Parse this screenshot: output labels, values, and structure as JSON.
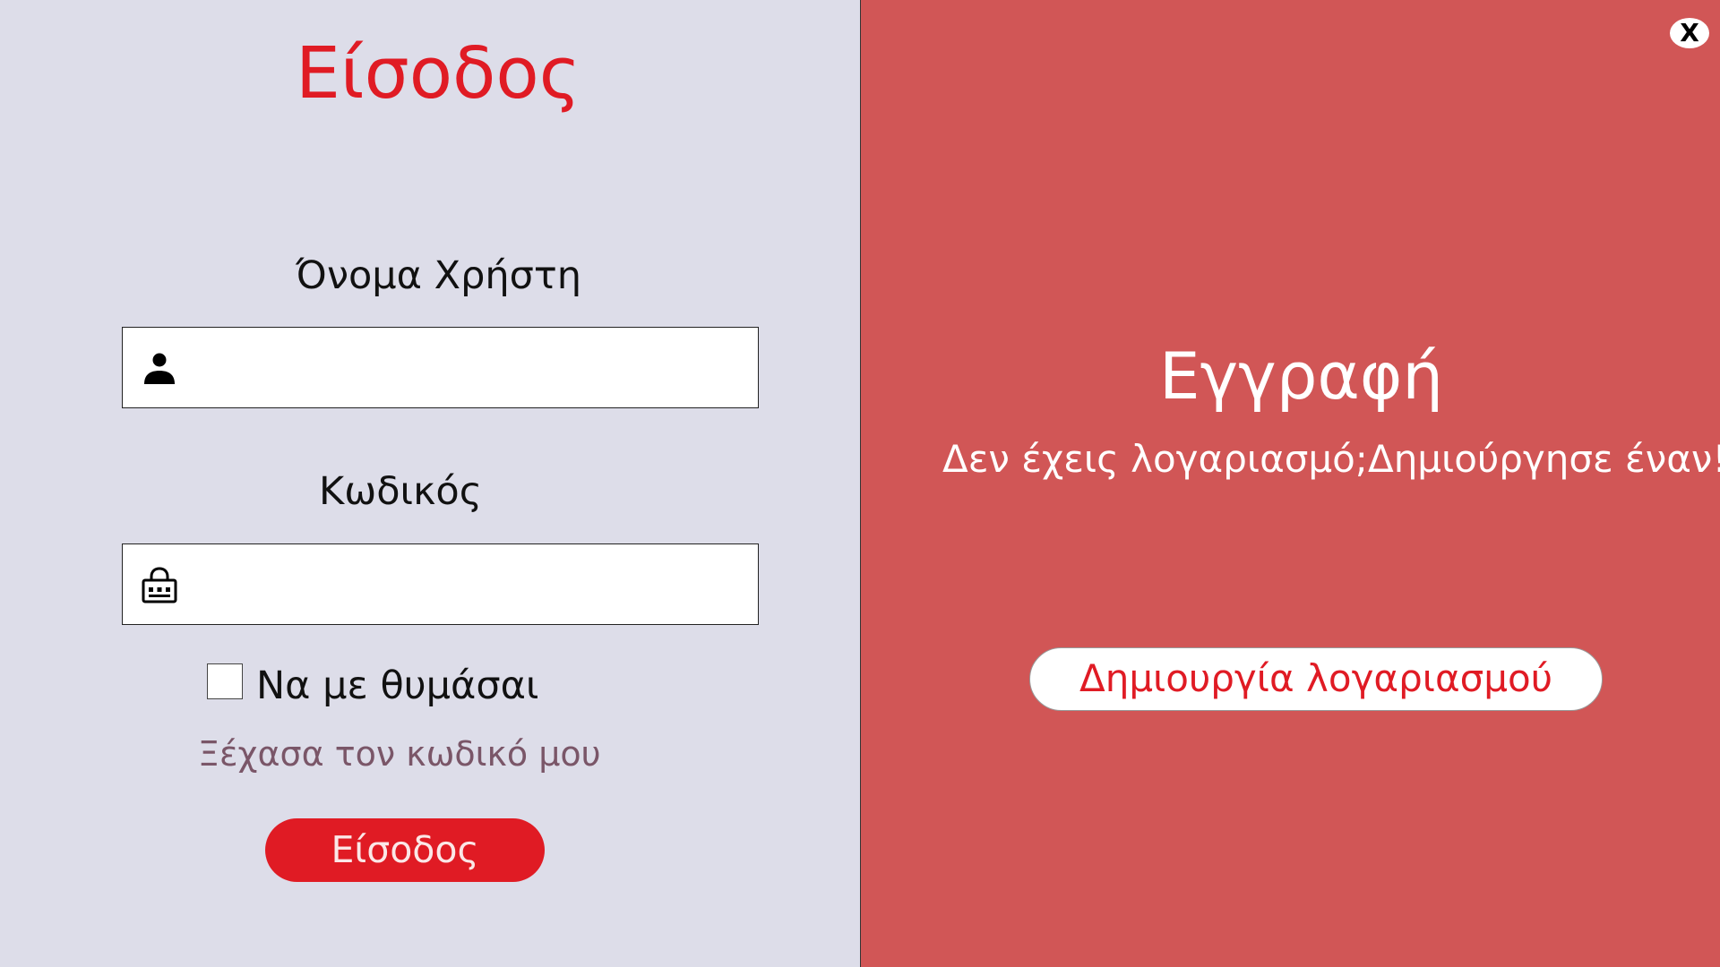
{
  "login": {
    "title": "Είσοδος",
    "username_label": "Όνομα Χρήστη",
    "username_value": "",
    "password_label": "Κωδικός",
    "password_value": "",
    "remember_label": "Να με θυμάσαι",
    "remember_checked": false,
    "forgot_link": "Ξέχασα τον κωδικό μου",
    "submit_label": "Είσοδος"
  },
  "register": {
    "title": "Εγγραφή",
    "subtitle": "Δεν έχεις λογαριασμό;Δημιούργησε έναν!",
    "create_button": "Δημιουργία λογαριασμού"
  },
  "window": {
    "close_label": "X"
  },
  "icons": {
    "username": "user-icon",
    "password": "keyboard-icon"
  },
  "colors": {
    "accent": "#e01b24",
    "left_background": "#dddde9",
    "right_background": "#d15656",
    "forgot_link": "#7a5668"
  }
}
